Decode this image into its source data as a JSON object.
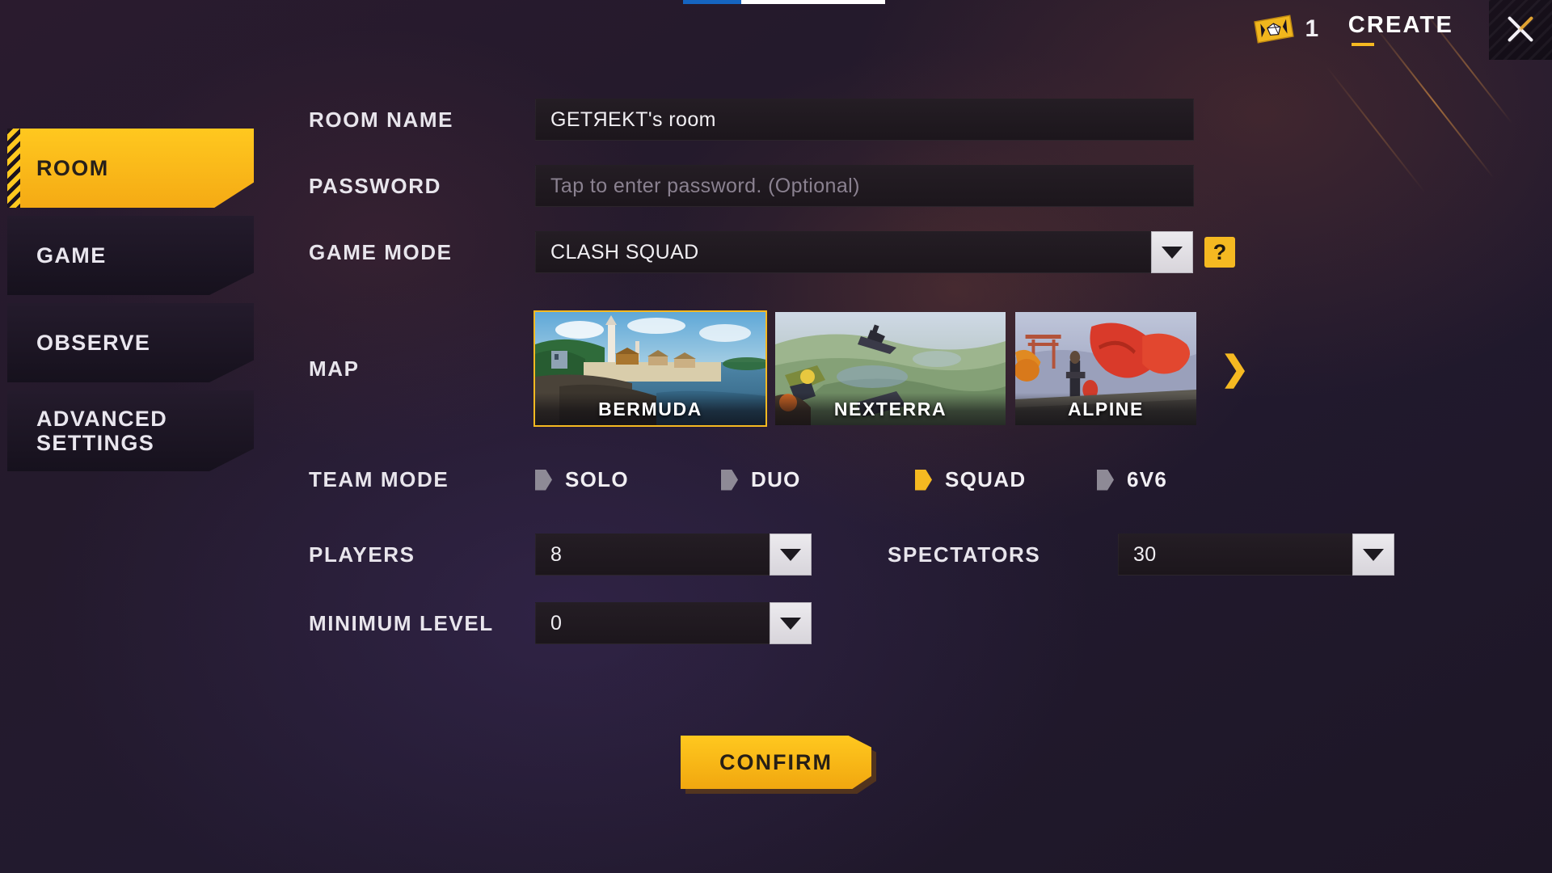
{
  "topbar": {
    "ticket_icon": "ticket-icon",
    "ticket_count": "1",
    "create_label": "CREATE",
    "close_icon": "close-icon"
  },
  "sidebar": {
    "items": [
      {
        "label": "ROOM",
        "active": true
      },
      {
        "label": "GAME",
        "active": false
      },
      {
        "label": "OBSERVE",
        "active": false
      },
      {
        "label": "ADVANCED SETTINGS",
        "active": false
      }
    ]
  },
  "form": {
    "room_name": {
      "label": "ROOM NAME",
      "value": "GETЯEKT's room"
    },
    "password": {
      "label": "PASSWORD",
      "value": "",
      "placeholder": "Tap to enter password. (Optional)"
    },
    "game_mode": {
      "label": "GAME MODE",
      "value": "CLASH SQUAD",
      "dropdown_icon": "chevron-down-icon",
      "help_label": "?"
    },
    "map": {
      "label": "MAP",
      "next_icon": "chevron-right-icon",
      "options": [
        {
          "name": "BERMUDA",
          "selected": true
        },
        {
          "name": "NEXTERRA",
          "selected": false
        },
        {
          "name": "ALPINE",
          "selected": false
        }
      ]
    },
    "team_mode": {
      "label": "TEAM MODE",
      "options": [
        {
          "label": "SOLO",
          "selected": false
        },
        {
          "label": "DUO",
          "selected": false
        },
        {
          "label": "SQUAD",
          "selected": true
        },
        {
          "label": "6V6",
          "selected": false
        }
      ]
    },
    "players": {
      "label": "PLAYERS",
      "value": "8",
      "dropdown_icon": "chevron-down-icon"
    },
    "spectators": {
      "label": "SPECTATORS",
      "value": "30",
      "dropdown_icon": "chevron-down-icon"
    },
    "minimum_level": {
      "label": "MINIMUM LEVEL",
      "value": "0",
      "dropdown_icon": "chevron-down-icon"
    }
  },
  "footer": {
    "confirm_label": "CONFIRM"
  },
  "colors": {
    "accent": "#f5b921",
    "accent_bright": "#ffc81f",
    "background": "#1d1626",
    "field": "#1f1920",
    "text": "#f0eef2",
    "muted": "#8a8190"
  }
}
